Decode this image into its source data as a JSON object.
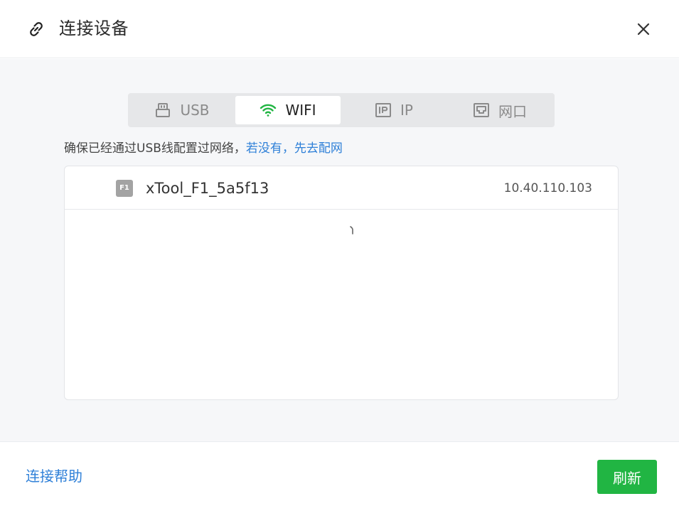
{
  "dialog": {
    "title": "连接设备",
    "icon": "link-icon",
    "close_icon": "close-icon"
  },
  "tabs": [
    {
      "label": "USB",
      "icon": "usb-icon",
      "active": false
    },
    {
      "label": "WIFI",
      "icon": "wifi-icon",
      "active": true
    },
    {
      "label": "IP",
      "icon": "ip-icon",
      "active": false
    },
    {
      "label": "网口",
      "icon": "ethernet-icon",
      "active": false
    }
  ],
  "hint": {
    "text": "确保已经通过USB线配置过网络，",
    "link": "若没有，先去配网"
  },
  "devices": [
    {
      "badge": "F1",
      "name": "xTool_F1_5a5f13",
      "ip": "10.40.110.103"
    }
  ],
  "footer": {
    "help_label": "连接帮助",
    "refresh_label": "刷新"
  },
  "colors": {
    "accent_green": "#21b543",
    "link_blue": "#2f80d8",
    "wifi_green": "#21b543"
  }
}
